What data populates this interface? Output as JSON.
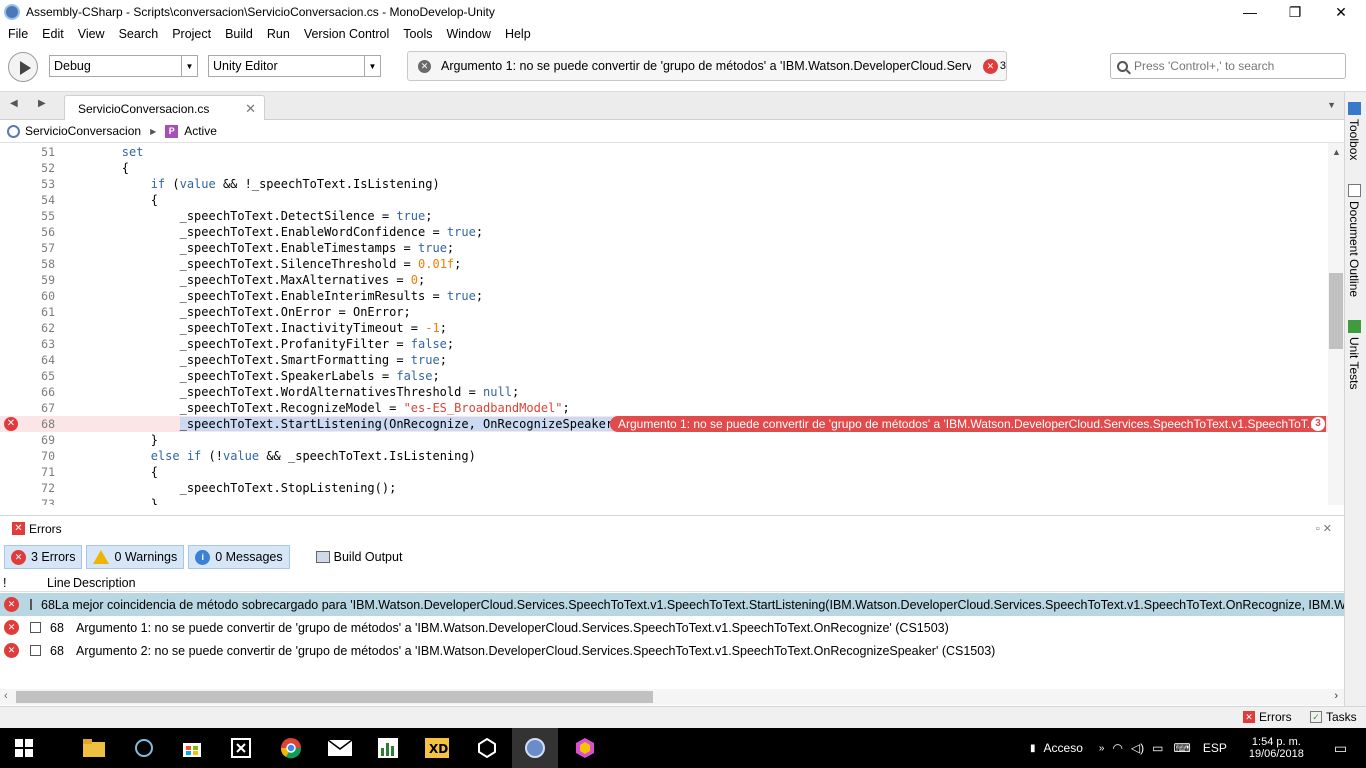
{
  "window": {
    "title": "Assembly-CSharp - Scripts\\conversacion\\ServicioConversacion.cs - MonoDevelop-Unity",
    "minimize": "—",
    "restore": "❐",
    "close": "✕"
  },
  "menu": [
    "File",
    "Edit",
    "View",
    "Search",
    "Project",
    "Build",
    "Run",
    "Version Control",
    "Tools",
    "Window",
    "Help"
  ],
  "toolbar": {
    "config": "Debug",
    "target": "Unity Editor",
    "status_message": "Argumento 1: no se puede convertir de 'grupo de métodos' a 'IBM.Watson.DeveloperCloud.Services...",
    "error_count": "3",
    "search_placeholder": "Press 'Control+,' to search"
  },
  "tabs": [
    {
      "label": "ServicioConversacion.cs"
    }
  ],
  "breadcrumb": {
    "class_name": "ServicioConversacion",
    "property_badge": "P",
    "member": "Active"
  },
  "editor": {
    "lines": [
      {
        "n": "51",
        "tokens": [
          {
            "t": "        "
          },
          {
            "t": "set",
            "c": "kw"
          }
        ]
      },
      {
        "n": "52",
        "tokens": [
          {
            "t": "        {"
          }
        ]
      },
      {
        "n": "53",
        "tokens": [
          {
            "t": "            "
          },
          {
            "t": "if",
            "c": "kw"
          },
          {
            "t": " ("
          },
          {
            "t": "value",
            "c": "kw"
          },
          {
            "t": " && !_speechToText.IsListening)"
          }
        ]
      },
      {
        "n": "54",
        "tokens": [
          {
            "t": "            {"
          }
        ]
      },
      {
        "n": "55",
        "tokens": [
          {
            "t": "                _speechToText.DetectSilence = "
          },
          {
            "t": "true",
            "c": "kw"
          },
          {
            "t": ";"
          }
        ]
      },
      {
        "n": "56",
        "tokens": [
          {
            "t": "                _speechToText.EnableWordConfidence = "
          },
          {
            "t": "true",
            "c": "kw"
          },
          {
            "t": ";"
          }
        ]
      },
      {
        "n": "57",
        "tokens": [
          {
            "t": "                _speechToText.EnableTimestamps = "
          },
          {
            "t": "true",
            "c": "kw"
          },
          {
            "t": ";"
          }
        ]
      },
      {
        "n": "58",
        "tokens": [
          {
            "t": "                _speechToText.SilenceThreshold = "
          },
          {
            "t": "0.01f",
            "c": "num-lit"
          },
          {
            "t": ";"
          }
        ]
      },
      {
        "n": "59",
        "tokens": [
          {
            "t": "                _speechToText.MaxAlternatives = "
          },
          {
            "t": "0",
            "c": "num-lit"
          },
          {
            "t": ";"
          }
        ]
      },
      {
        "n": "60",
        "tokens": [
          {
            "t": "                _speechToText.EnableInterimResults = "
          },
          {
            "t": "true",
            "c": "kw"
          },
          {
            "t": ";"
          }
        ]
      },
      {
        "n": "61",
        "tokens": [
          {
            "t": "                _speechToText.OnError = OnError;"
          }
        ]
      },
      {
        "n": "62",
        "tokens": [
          {
            "t": "                _speechToText.InactivityTimeout = "
          },
          {
            "t": "-1",
            "c": "num-lit"
          },
          {
            "t": ";"
          }
        ]
      },
      {
        "n": "63",
        "tokens": [
          {
            "t": "                _speechToText.ProfanityFilter = "
          },
          {
            "t": "false",
            "c": "kw"
          },
          {
            "t": ";"
          }
        ]
      },
      {
        "n": "64",
        "tokens": [
          {
            "t": "                _speechToText.SmartFormatting = "
          },
          {
            "t": "true",
            "c": "kw"
          },
          {
            "t": ";"
          }
        ]
      },
      {
        "n": "65",
        "tokens": [
          {
            "t": "                _speechToText.SpeakerLabels = "
          },
          {
            "t": "false",
            "c": "kw"
          },
          {
            "t": ";"
          }
        ]
      },
      {
        "n": "66",
        "tokens": [
          {
            "t": "                _speechToText.WordAlternativesThreshold = "
          },
          {
            "t": "null",
            "c": "kw"
          },
          {
            "t": ";"
          }
        ]
      },
      {
        "n": "67",
        "tokens": [
          {
            "t": "                _speechToText.RecognizeModel = "
          },
          {
            "t": "\"es-ES_BroadbandModel\"",
            "c": "str"
          },
          {
            "t": ";"
          }
        ]
      },
      {
        "n": "68",
        "error": true,
        "tokens": [
          {
            "t": "                "
          },
          {
            "t": "_speechToText.StartListening(OnRecognize, OnRecognizeSpeaker);",
            "c": "sel"
          }
        ]
      },
      {
        "n": "69",
        "tokens": [
          {
            "t": "            }"
          }
        ]
      },
      {
        "n": "70",
        "tokens": [
          {
            "t": "            "
          },
          {
            "t": "else if",
            "c": "kw"
          },
          {
            "t": " (!"
          },
          {
            "t": "value",
            "c": "kw"
          },
          {
            "t": " && _speechToText.IsListening)"
          }
        ]
      },
      {
        "n": "71",
        "tokens": [
          {
            "t": "            {"
          }
        ]
      },
      {
        "n": "72",
        "tokens": [
          {
            "t": "                _speechToText.StopListening();"
          }
        ]
      },
      {
        "n": "73",
        "tokens": [
          {
            "t": "            }"
          }
        ]
      }
    ],
    "inline_error": {
      "text": "Argumento 1: no se puede convertir de 'grupo de métodos' a 'IBM.Watson.DeveloperCloud.Services.SpeechToText.v1.SpeechToT...",
      "count": "3"
    }
  },
  "right_sidebar": [
    "Toolbox",
    "Document Outline",
    "Unit Tests"
  ],
  "errors_pad": {
    "title": "Errors",
    "filters": {
      "errors": "3 Errors",
      "warnings": "0 Warnings",
      "messages": "0 Messages",
      "build_output": "Build Output"
    },
    "columns": {
      "flag": "!",
      "line": "Line",
      "description": "Description"
    },
    "rows": [
      {
        "line": "68",
        "description": "La mejor coincidencia de método sobrecargado para 'IBM.Watson.DeveloperCloud.Services.SpeechToText.v1.SpeechToText.StartListening(IBM.Watson.DeveloperCloud.Services.SpeechToText.v1.SpeechToText.OnRecognize, IBM.Watson.Deve"
      },
      {
        "line": "68",
        "description": "Argumento 1: no se puede convertir de 'grupo de métodos' a 'IBM.Watson.DeveloperCloud.Services.SpeechToText.v1.SpeechToText.OnRecognize' (CS1503)"
      },
      {
        "line": "68",
        "description": "Argumento 2: no se puede convertir de 'grupo de métodos' a 'IBM.Watson.DeveloperCloud.Services.SpeechToText.v1.SpeechToText.OnRecognizeSpeaker' (CS1503)"
      }
    ]
  },
  "statusbar": {
    "errors": "Errors",
    "tasks": "Tasks"
  },
  "taskbar": {
    "acceso": "Acceso",
    "lang": "ESP",
    "time": "1:54 p. m.",
    "date": "19/06/2018"
  }
}
